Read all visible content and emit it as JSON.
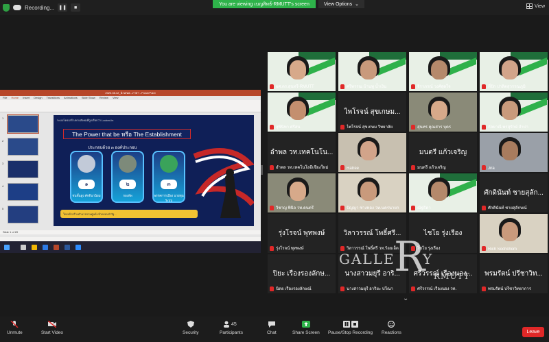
{
  "topbar": {
    "recording_label": "Recording...",
    "viewing_label": "You are viewing เบญสิทธ์-RMUTT's screen",
    "view_options_label": "View Options",
    "view_label": "View"
  },
  "share": {
    "window_title": "2020.08.12_นำเสนอ...ภาษา - PowerPoint",
    "tabs": [
      "File",
      "Home",
      "Insert",
      "Design",
      "Transitions",
      "Animations",
      "Slide Show",
      "Review",
      "View"
    ],
    "slide_intro": "ระบบโครงสร้างทางสังคมที่ถูกเรียกว่า Locked-in",
    "slide_heading": "The Power that be หรือ The Establishment",
    "slide_sub": "ประกอบด้วย ๓ องค์ประกอบ",
    "boxes": [
      {
        "num": "๑",
        "label": "ชนชั้นสูง ศักดินานิยม"
      },
      {
        "num": "๒",
        "label": "กองทัพ"
      },
      {
        "num": "๓",
        "label": "พรรคการเมือง นายทุนระบบ"
      }
    ],
    "slide_bottom": "ใครเข้าสร้างอำนาจรวมศูนย์ เข้าครอบงำรัฐ...",
    "status": "Slide 1 of 20"
  },
  "tiles": [
    {
      "name": "ผศ.ดร.สุนทรี-RMUTT",
      "active": true
    },
    {
      "name": "ศรีพรรณ บ้านพู น้ำเงิน",
      "kind": "face"
    },
    {
      "name": "จิราภรณ์ วงศ์สุดใจ",
      "kind": "face"
    },
    {
      "name": "ที่ปัก ปาลิตสุวรรณภูมิ",
      "kind": "face"
    },
    {
      "name": "สุพินิทา ศรีสน",
      "kind": "face"
    },
    {
      "name": "ไพโรจน์ สุขเกษม วิทยาลัย",
      "big": "ไพโรจน์ สุขเกษม...",
      "kind": "text"
    },
    {
      "name": "สุนทร คุณสาร บุตร",
      "kind": "face"
    },
    {
      "name": "กัลยาณี พรสุรักษ์ จำปา",
      "kind": "face"
    },
    {
      "name": "อำพล วท.เทคโนโลยีเชียงใหม่",
      "big": "อำพล วท.เทคโนโน...",
      "kind": "text"
    },
    {
      "name": "Ratree",
      "kind": "face"
    },
    {
      "name": "มนตรี แก้วเจริญ",
      "big": "มนตรี แก้วเจริญ",
      "kind": "text"
    },
    {
      "name": "Jira",
      "kind": "face"
    },
    {
      "name": "วิชาญ พินิจ วท.ดนตรี",
      "kind": "face"
    },
    {
      "name": "ปัญญา ช่างทอง วท.นครนายก",
      "kind": "face"
    },
    {
      "name": "ณัฐธิดา",
      "kind": "face"
    },
    {
      "name": "ศักดินันท์ ชายสุลักษณ์",
      "big": "ศักดินันท์ ชายสุลัก...",
      "kind": "text"
    },
    {
      "name": "รุ่งโรจน์ พุทพงษ์",
      "big": "รุ่งโรจน์ พุทพงษ์",
      "kind": "text"
    },
    {
      "name": "วิลาวรรณ์ โพธิ์ศรี วท.ร้อยเอ็ด",
      "big": "วิลาวรรณ์ โพธิ์ศรี...",
      "kind": "text"
    },
    {
      "name": "ไชโย รุ่งเรือง",
      "big": "ไชโย รุ่งเรือง",
      "kind": "text"
    },
    {
      "name": "Rich Sochchom",
      "kind": "face"
    },
    {
      "name": "นิตย เรืองรองลักษณ์",
      "big": "ปิยะ เรืองรองลักษ...",
      "kind": "text"
    },
    {
      "name": "นางสาวมยุรี อาริยะ ปวีณา",
      "big": "นางสาวมยุรี อาริ...",
      "kind": "text"
    },
    {
      "name": "ศรีวรรณ์ เรืองนอง วท.",
      "big": "ศรีวรรณ์ เรืองนอง...",
      "kind": "text"
    },
    {
      "name": "พรมรัตน์ ปรีชาวิทยาการ",
      "big": "พรมรัตน์ ปรีชาวิท...",
      "kind": "text"
    }
  ],
  "toolbar": {
    "items": [
      {
        "label": "Unmute",
        "icon": "mic-muted-icon"
      },
      {
        "label": "Start Video",
        "icon": "video-off-icon"
      },
      {
        "label": "Security",
        "icon": "shield-icon"
      },
      {
        "label": "Participants",
        "icon": "participants-icon",
        "count": "45"
      },
      {
        "label": "Chat",
        "icon": "chat-icon"
      },
      {
        "label": "Share Screen",
        "icon": "share-screen-icon"
      },
      {
        "label": "Pause/Stop Recording",
        "icon": "pause-recording-icon"
      },
      {
        "label": "Reactions",
        "icon": "reactions-icon"
      }
    ],
    "leave_label": "Leave"
  },
  "watermark": {
    "text1": "GALLE",
    "text2": "R",
    "text3": "Y",
    "text4": "RMUTT"
  },
  "colors": {
    "accent": "#2eb34a",
    "leave": "#e02828",
    "active_speaker": "#e5e500"
  }
}
